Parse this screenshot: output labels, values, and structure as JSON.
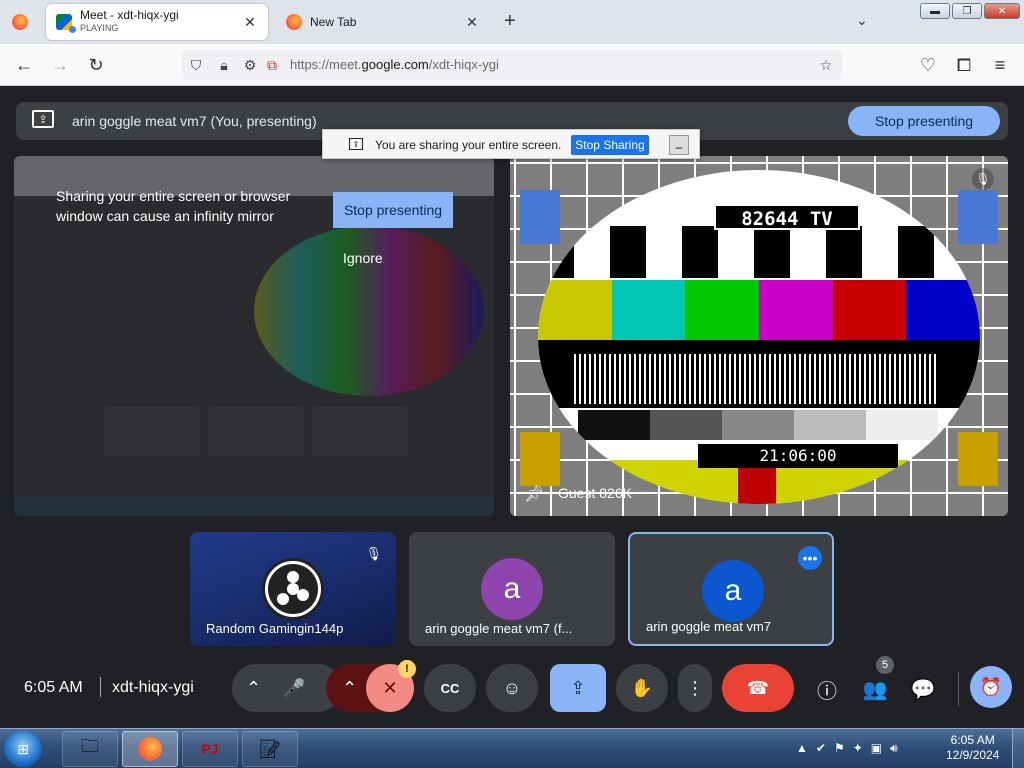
{
  "browser": {
    "tabs": [
      {
        "title": "Meet - xdt-hiqx-ygi",
        "status": "PLAYING",
        "close": "✕"
      },
      {
        "title": "New Tab",
        "close": "✕"
      }
    ],
    "new_tab": "+",
    "tab_list": "⌄",
    "window_controls": {
      "minimize": "▬",
      "maximize": "❐",
      "close": "✕"
    },
    "url_prefix": "https://meet.",
    "url_domain": "google.com",
    "url_path": "/xdt-hiqx-ygi",
    "icons": [
      "back-arrow-icon",
      "forward-arrow-icon",
      "reload-icon",
      "shield-icon",
      "lock-icon",
      "permissions-icon",
      "screen-share-icon",
      "bookmark-star-icon",
      "pocket-icon",
      "extensions-icon",
      "menu-icon"
    ]
  },
  "meet": {
    "banner_text": "arin goggle meat vm7 (You, presenting)",
    "stop_presenting": "Stop presenting",
    "share_bar": {
      "text": "You are sharing your entire screen.",
      "button": "Stop Sharing",
      "minimize": "–"
    },
    "mirror": {
      "message": "Sharing your entire screen or browser window can cause an infinity mirror",
      "stop_button": "Stop presenting",
      "ignore": "Ignore"
    },
    "guest": {
      "name": "Guest 826K",
      "tv_label": "82644 TV",
      "tv_time": "21:06:00",
      "test_colors": [
        "#c8c800",
        "#00c8b4",
        "#00c800",
        "#c800c8",
        "#c80000",
        "#0000c8"
      ]
    },
    "tiles": [
      {
        "name": "Random Gamingin144p",
        "avatar": ""
      },
      {
        "name": "arin goggle meat vm7 (f...",
        "avatar": "a",
        "color": "#8e44ad"
      },
      {
        "name": "arin goggle meat vm7",
        "avatar": "a",
        "color": "#0b57d0"
      }
    ],
    "time": "6:05 AM",
    "code": "xdt-hiqx-ygi",
    "warn_badge": "!",
    "participant_count": "5",
    "controls": {
      "mic_options": "⌃",
      "mic": "🎤",
      "cam_options": "⌃",
      "cam": "✕",
      "captions": "CC",
      "emoji": "☺",
      "present": "⇪",
      "hand": "✋",
      "more": "⋮",
      "hangup": "☎",
      "info": "ⓘ",
      "people": "👥",
      "chat": "💬",
      "activities": "⏰"
    }
  },
  "taskbar": {
    "time": "6:05 AM",
    "date": "12/9/2024",
    "apps": [
      "explorer",
      "firefox",
      "pj64",
      "notepad"
    ]
  }
}
